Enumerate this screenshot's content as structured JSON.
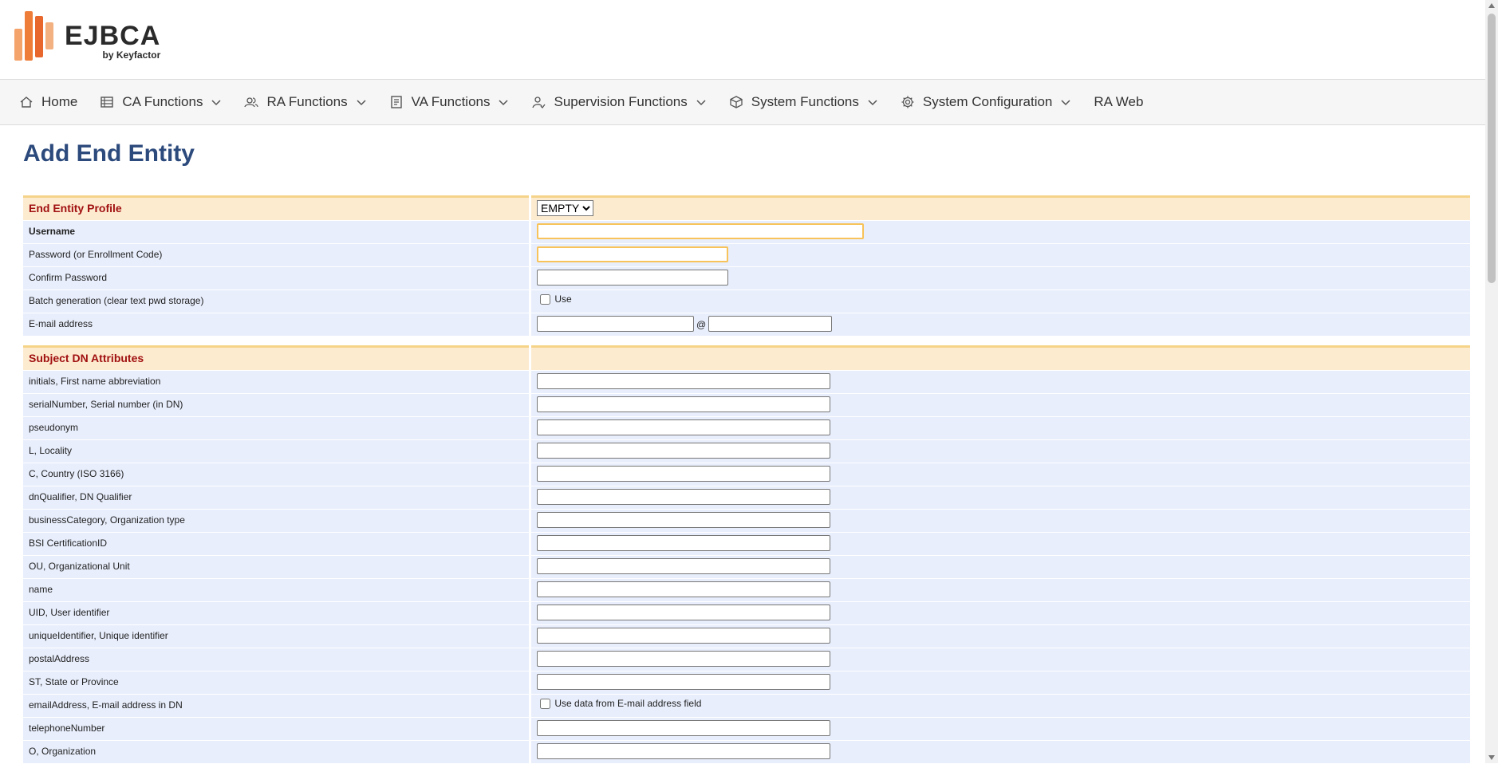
{
  "logo": {
    "name": "EJBCA",
    "by": "by Keyfactor",
    "colors": [
      "#f79a5a",
      "#f2803d",
      "#e8672c",
      "#f0a070"
    ]
  },
  "nav": {
    "items": [
      {
        "label": "Home",
        "icon": "home-icon",
        "dropdown": false
      },
      {
        "label": "CA Functions",
        "icon": "ca-list-icon",
        "dropdown": true
      },
      {
        "label": "RA Functions",
        "icon": "users-icon",
        "dropdown": true
      },
      {
        "label": "VA Functions",
        "icon": "document-icon",
        "dropdown": true
      },
      {
        "label": "Supervision Functions",
        "icon": "supervisor-icon",
        "dropdown": true
      },
      {
        "label": "System Functions",
        "icon": "cube-icon",
        "dropdown": true
      },
      {
        "label": "System Configuration",
        "icon": "gear-icon",
        "dropdown": true
      },
      {
        "label": "RA Web",
        "icon": "",
        "dropdown": false
      }
    ]
  },
  "page": {
    "title": "Add End Entity"
  },
  "profile_section": {
    "heading": "End Entity Profile",
    "selected_profile": "EMPTY",
    "username_label": "Username",
    "username_value": "",
    "password_label": "Password (or Enrollment Code)",
    "password_value": "",
    "confirm_label": "Confirm Password",
    "confirm_value": "",
    "batch_label": "Batch generation (clear text pwd storage)",
    "batch_checkbox_label": "Use",
    "batch_checked": false,
    "email_label": "E-mail address",
    "email_user": "",
    "email_at": "@",
    "email_domain": ""
  },
  "subject_dn": {
    "heading": "Subject DN Attributes",
    "fields": [
      {
        "label": "initials, First name abbreviation",
        "value": ""
      },
      {
        "label": "serialNumber, Serial number (in DN)",
        "value": ""
      },
      {
        "label": "pseudonym",
        "value": ""
      },
      {
        "label": "L, Locality",
        "value": ""
      },
      {
        "label": "C, Country (ISO 3166)",
        "value": ""
      },
      {
        "label": "dnQualifier, DN Qualifier",
        "value": ""
      },
      {
        "label": "businessCategory, Organization type",
        "value": ""
      },
      {
        "label": "BSI CertificationID",
        "value": ""
      },
      {
        "label": "OU, Organizational Unit",
        "value": ""
      },
      {
        "label": "name",
        "value": ""
      },
      {
        "label": "UID, User identifier",
        "value": ""
      },
      {
        "label": "uniqueIdentifier, Unique identifier",
        "value": ""
      },
      {
        "label": "postalAddress",
        "value": ""
      },
      {
        "label": "ST, State or Province",
        "value": ""
      }
    ],
    "email_dn_label": "emailAddress, E-mail address in DN",
    "email_dn_checkbox_label": "Use data from E-mail address field",
    "email_dn_checked": false,
    "trailing_fields": [
      {
        "label": "telephoneNumber",
        "value": ""
      },
      {
        "label": "O, Organization",
        "value": ""
      }
    ]
  },
  "theme": {
    "title_color": "#2c4a7c",
    "section_bg": "#fdebd0",
    "section_text": "#a01010",
    "row_bg": "#e8eefc",
    "required_border": "#f7c35a"
  }
}
